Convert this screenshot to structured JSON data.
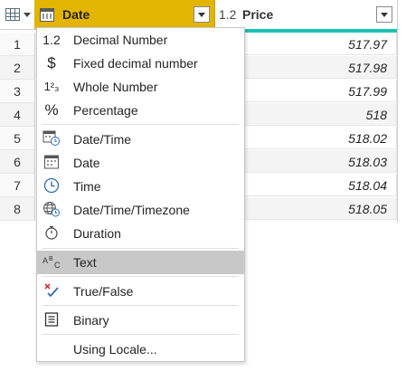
{
  "header": {
    "date_col_label": "Date",
    "price_col_type": "1.2",
    "price_col_label": "Price"
  },
  "rows": [
    {
      "num": "1",
      "price": "517.97"
    },
    {
      "num": "2",
      "price": "517.98"
    },
    {
      "num": "3",
      "price": "517.99"
    },
    {
      "num": "4",
      "price": "518"
    },
    {
      "num": "5",
      "price": "518.02"
    },
    {
      "num": "6",
      "price": "518.03"
    },
    {
      "num": "7",
      "price": "518.04"
    },
    {
      "num": "8",
      "price": "518.05"
    }
  ],
  "menu": {
    "items": [
      {
        "icon_text": "1.2",
        "icon": "decimal-icon",
        "label": "Decimal Number"
      },
      {
        "icon_text": "$",
        "icon": "dollar-icon",
        "label": "Fixed decimal number"
      },
      {
        "icon_text": "1²₃",
        "icon": "whole-number-icon",
        "label": "Whole Number"
      },
      {
        "icon_text": "%",
        "icon": "percent-icon",
        "label": "Percentage"
      },
      {
        "icon": "datetime-icon",
        "label": "Date/Time"
      },
      {
        "icon": "calendar-icon",
        "label": "Date"
      },
      {
        "icon": "clock-icon",
        "label": "Time"
      },
      {
        "icon": "globe-clock-icon",
        "label": "Date/Time/Timezone"
      },
      {
        "icon": "stopwatch-icon",
        "label": "Duration"
      },
      {
        "icon_text": "ABC",
        "icon": "text-type-icon",
        "label": "Text",
        "selected": true
      },
      {
        "icon": "true-false-icon",
        "label": "True/False"
      },
      {
        "icon": "binary-icon",
        "label": "Binary"
      },
      {
        "label": "Using Locale..."
      }
    ]
  },
  "colors": {
    "date_header_bg": "#e3b500",
    "quality_bar": "#1bc3b3",
    "selected_item_bg": "#c8c8c8"
  }
}
